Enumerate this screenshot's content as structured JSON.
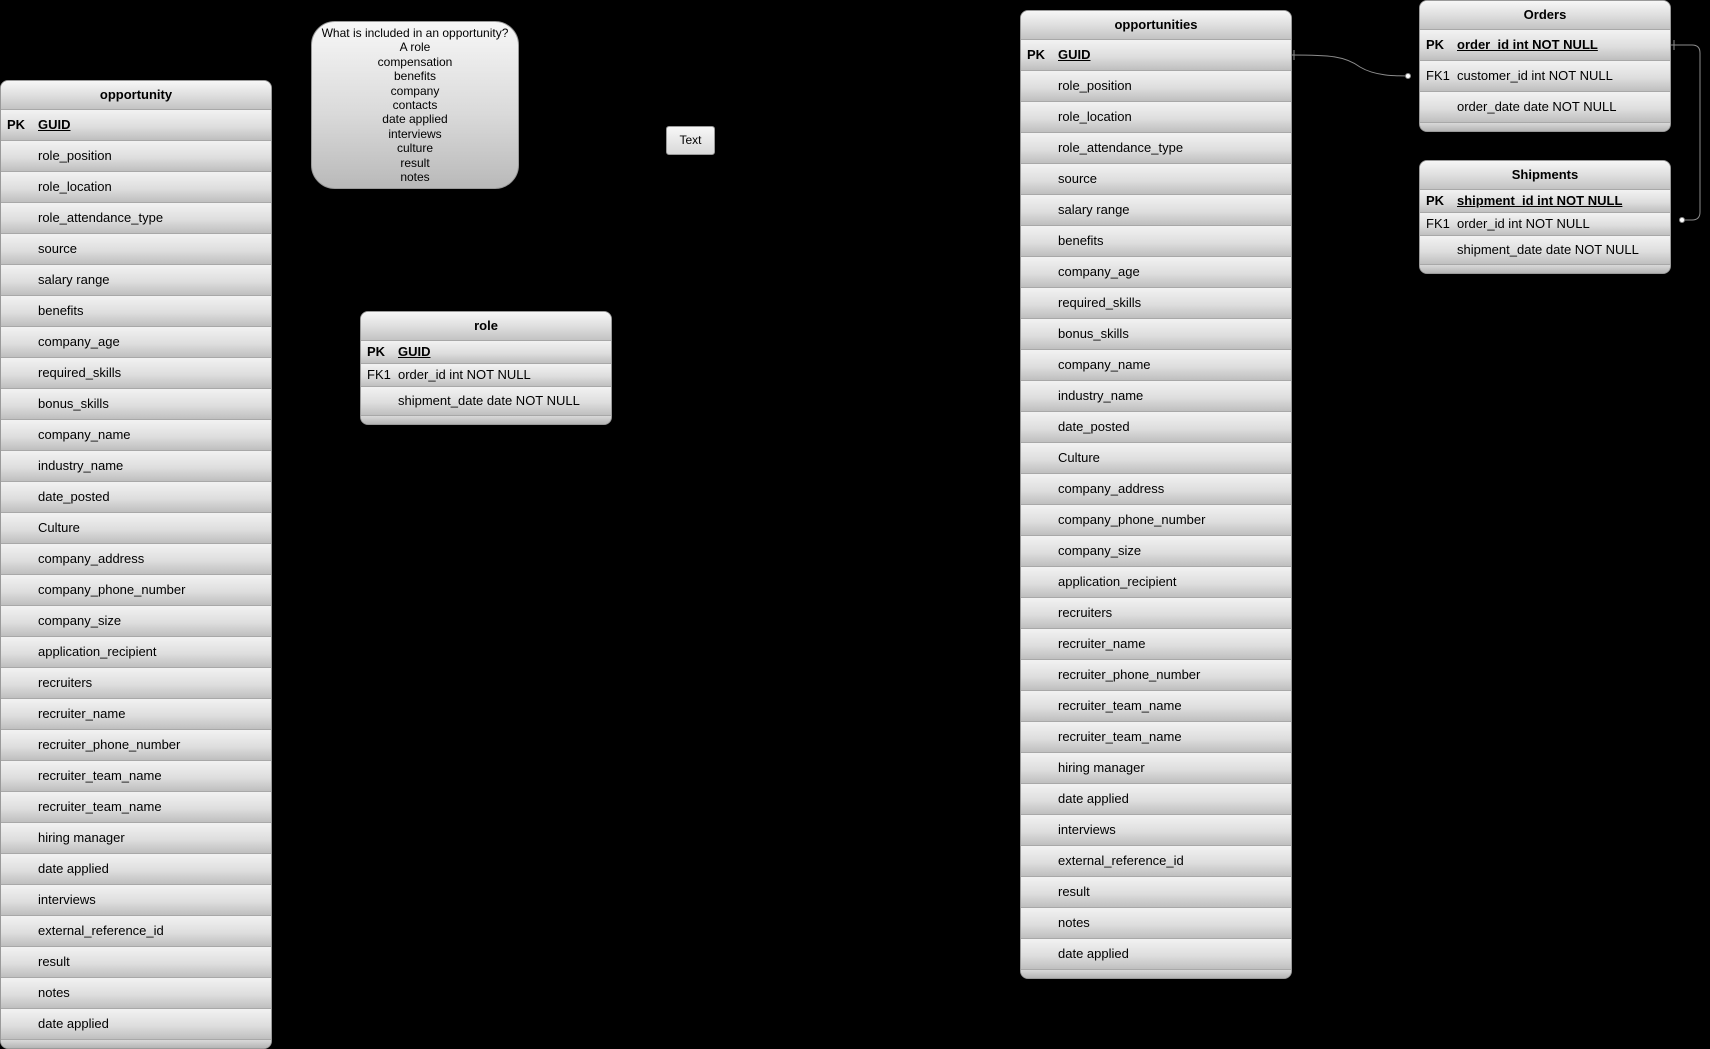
{
  "note": {
    "lines": [
      "What is included in an opportunity?",
      "A role",
      "compensation",
      "benefits",
      "company",
      "contacts",
      "date applied",
      "interviews",
      "culture",
      "result",
      "notes"
    ]
  },
  "text_box": {
    "label": "Text"
  },
  "tables": {
    "opportunity": {
      "title": "opportunity",
      "pk_label": "PK",
      "pk_field": "GUID",
      "fields": [
        "role_position",
        "role_location",
        "role_attendance_type",
        "source",
        "salary range",
        "benefits",
        "company_age",
        "required_skills",
        "bonus_skills",
        "company_name",
        "industry_name",
        "date_posted",
        "Culture",
        "company_address",
        "company_phone_number",
        "company_size",
        "application_recipient",
        "recruiters",
        "recruiter_name",
        "recruiter_phone_number",
        "recruiter_team_name",
        "recruiter_team_name",
        "hiring manager",
        "date applied",
        "interviews",
        "external_reference_id",
        "result",
        "notes",
        "date applied"
      ]
    },
    "opportunities": {
      "title": "opportunities",
      "pk_label": "PK",
      "pk_field": "GUID",
      "fields": [
        "role_position",
        "role_location",
        "role_attendance_type",
        "source",
        "salary range",
        "benefits",
        "company_age",
        "required_skills",
        "bonus_skills",
        "company_name",
        "industry_name",
        "date_posted",
        "Culture",
        "company_address",
        "company_phone_number",
        "company_size",
        "application_recipient",
        "recruiters",
        "recruiter_name",
        "recruiter_phone_number",
        "recruiter_team_name",
        "recruiter_team_name",
        "hiring manager",
        "date applied",
        "interviews",
        "external_reference_id",
        "result",
        "notes",
        "date applied"
      ]
    },
    "role": {
      "title": "role",
      "pk_label": "PK",
      "pk_field": "GUID",
      "fk_label": "FK1",
      "fk_field": "order_id int NOT NULL",
      "extra_field": "shipment_date date NOT NULL"
    },
    "orders": {
      "title": "Orders",
      "pk_label": "PK",
      "pk_field": "order_id int NOT NULL",
      "fk_label": "FK1",
      "fk_field": "customer_id int NOT NULL",
      "extra_field": "order_date date NOT NULL"
    },
    "shipments": {
      "title": "Shipments",
      "pk_label": "PK",
      "pk_field": "shipment_id int NOT NULL",
      "fk_label": "FK1",
      "fk_field": "order_id int NOT NULL",
      "extra_field": "shipment_date date NOT NULL"
    }
  }
}
